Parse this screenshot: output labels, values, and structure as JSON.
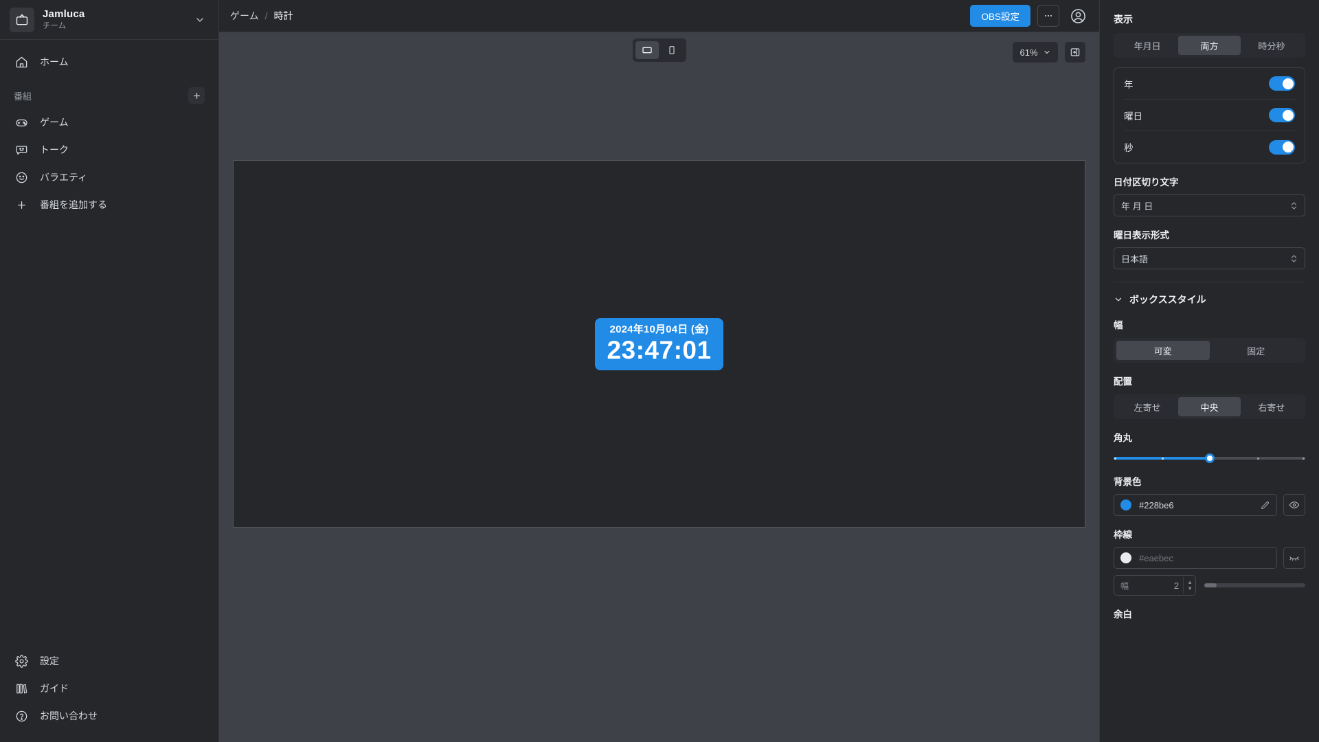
{
  "sidebar": {
    "team": {
      "name": "Jamluca",
      "subtitle": "チーム",
      "logo_icon": "tv-icon",
      "chevron_icon": "chevron-down-icon"
    },
    "primary_items": [
      {
        "label": "ホーム",
        "icon": "home-icon"
      }
    ],
    "group": {
      "title": "番組",
      "add_icon": "plus-icon"
    },
    "program_items": [
      {
        "label": "ゲーム",
        "icon": "gamepad-icon"
      },
      {
        "label": "トーク",
        "icon": "chat-icon"
      },
      {
        "label": "バラエティ",
        "icon": "smiley-icon"
      },
      {
        "label": "番組を追加する",
        "icon": "plus-square-icon"
      }
    ],
    "bottom_items": [
      {
        "label": "設定",
        "icon": "gear-icon"
      },
      {
        "label": "ガイド",
        "icon": "books-icon"
      },
      {
        "label": "お問い合わせ",
        "icon": "question-circle-icon"
      }
    ]
  },
  "topbar": {
    "breadcrumb": [
      "ゲーム",
      "時計"
    ],
    "separator": "/",
    "obs_button": "OBS設定",
    "more_icon": "ellipsis-icon",
    "account_icon": "user-circle-icon"
  },
  "stage": {
    "orientation_options": [
      {
        "name": "landscape",
        "icon": "landscape-icon",
        "active": true
      },
      {
        "name": "portrait",
        "icon": "portrait-icon",
        "active": false
      }
    ],
    "zoom_level": "61%",
    "zoom_chevron_icon": "chevron-down-icon",
    "panel_toggle_icon": "panel-collapse-icon",
    "clock": {
      "date": "2024年10月04日 (金)",
      "time": "23:47:01",
      "background_color": "#228be6",
      "text_color": "#ffffff"
    }
  },
  "panel": {
    "display_section": {
      "title": "表示",
      "mode_options": [
        "年月日",
        "両方",
        "時分秒"
      ],
      "mode_selected": "両方",
      "toggles": [
        {
          "label": "年",
          "on": true
        },
        {
          "label": "曜日",
          "on": true
        },
        {
          "label": "秒",
          "on": true
        }
      ]
    },
    "date_separator": {
      "label": "日付区切り文字",
      "value": "年 月 日"
    },
    "weekday_format": {
      "label": "曜日表示形式",
      "value": "日本語"
    },
    "box_style": {
      "title": "ボックススタイル",
      "collapse_icon": "chevron-down-icon",
      "width": {
        "label": "幅",
        "options": [
          "可変",
          "固定"
        ],
        "selected": "可変"
      },
      "align": {
        "label": "配置",
        "options": [
          "左寄せ",
          "中央",
          "右寄せ"
        ],
        "selected": "中央"
      },
      "corner_radius": {
        "label": "角丸",
        "value": 2,
        "min": 0,
        "max": 4,
        "steps": 5
      },
      "background_color": {
        "label": "背景色",
        "value": "#228be6",
        "swatch": "#228be6",
        "edit_icon": "pencil-icon",
        "visibility_icon": "eye-icon"
      },
      "border": {
        "label": "枠線",
        "value": "#eaebec",
        "swatch": "#eaebec",
        "disabled": true,
        "visibility_icon": "eye-off-icon",
        "width_label": "幅",
        "width_value": "2"
      },
      "padding": {
        "label": "余白"
      }
    }
  },
  "colors": {
    "accent": "#228be6",
    "panel_bg": "#26272b",
    "stage_bg": "#3f4148",
    "border": "#36373c"
  }
}
